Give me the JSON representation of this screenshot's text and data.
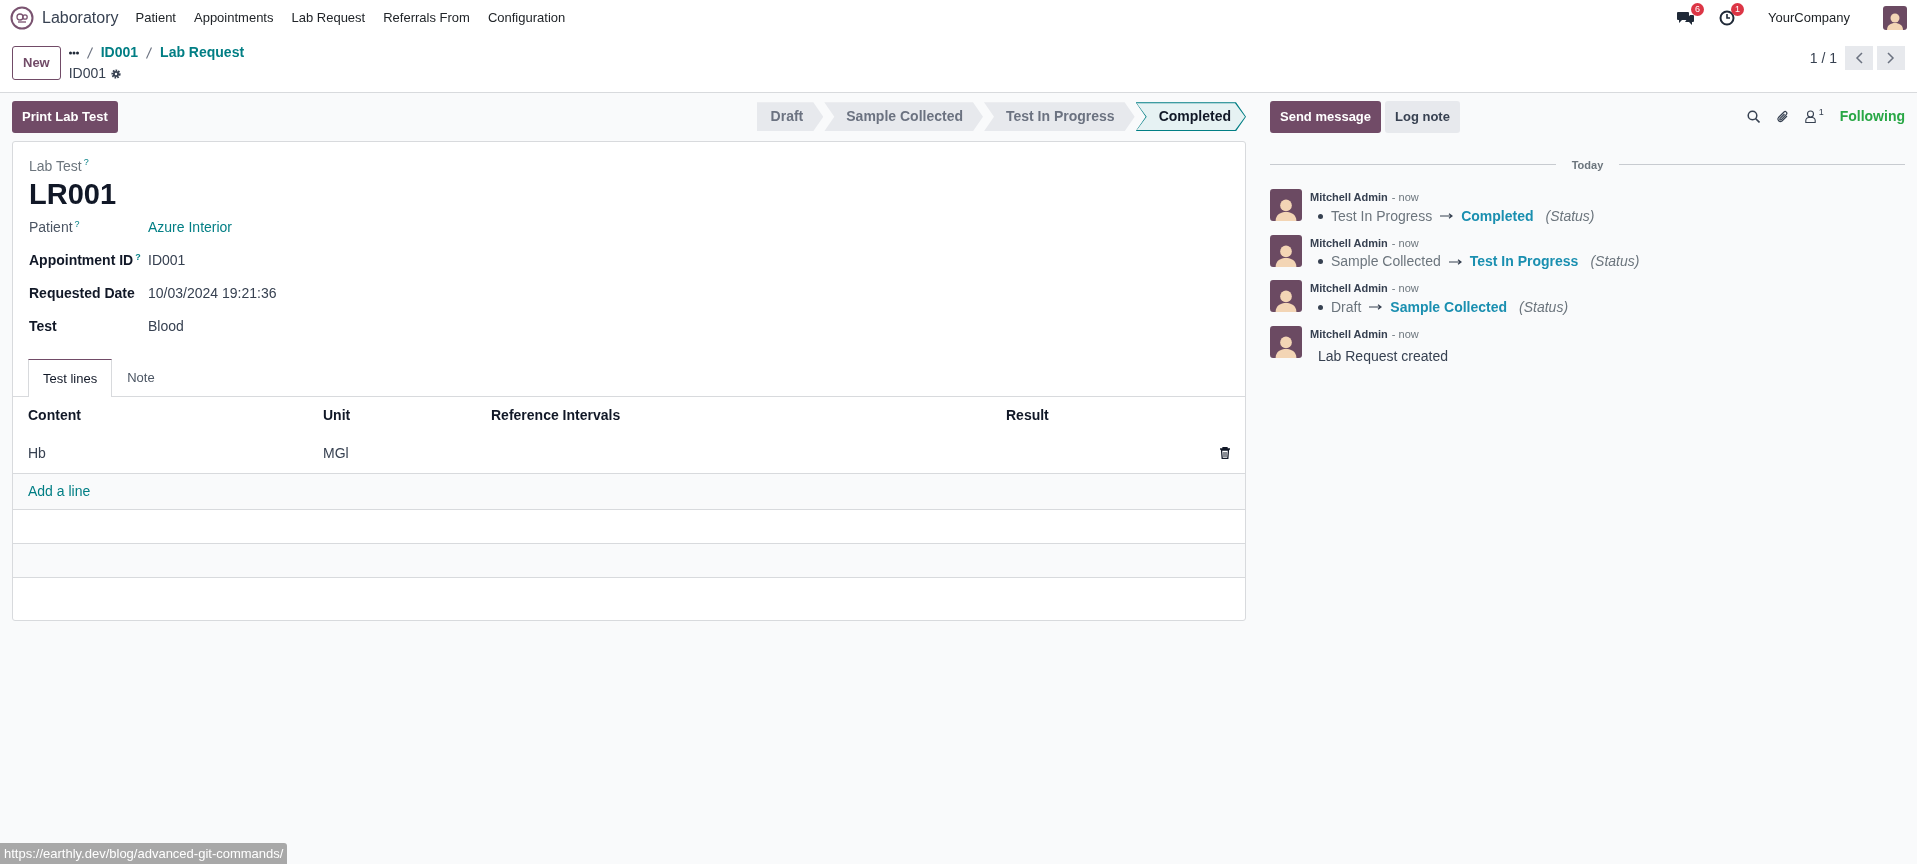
{
  "navbar": {
    "app": "Laboratory",
    "menu": [
      "Patient",
      "Appointments",
      "Lab Request",
      "Referrals From",
      "Configuration"
    ],
    "messages_count": "6",
    "activities_count": "1",
    "company": "YourCompany"
  },
  "control_panel": {
    "new_button": "New",
    "breadcrumbs": [
      "ID001",
      "Lab Request"
    ],
    "record": "ID001",
    "pager": "1 / 1"
  },
  "form": {
    "print_button": "Print Lab Test",
    "stages": [
      {
        "label": "Draft",
        "selected": false
      },
      {
        "label": "Sample Collected",
        "selected": false
      },
      {
        "label": "Test In Progress",
        "selected": false
      },
      {
        "label": "Completed",
        "selected": true
      }
    ],
    "title_label": "Lab Test",
    "title_help": "?",
    "title": "LR001",
    "fields": [
      {
        "label": "Patient",
        "help": "?",
        "value": "Azure Interior",
        "kind": "link"
      },
      {
        "label": "Appointment ID",
        "help": "?",
        "value": "ID001",
        "kind": "text"
      },
      {
        "label": "Requested Date",
        "value": "10/03/2024 19:21:36",
        "kind": "text"
      },
      {
        "label": "Test",
        "value": "Blood",
        "kind": "text"
      }
    ],
    "tabs": [
      {
        "label": "Test lines",
        "selected": true
      },
      {
        "label": "Note",
        "selected": false
      }
    ],
    "table": {
      "columns": [
        "Content",
        "Unit",
        "Reference Intervals",
        "Result"
      ],
      "rows": [
        {
          "content": "Hb",
          "unit": "MGl"
        }
      ],
      "add_line": "Add a line"
    }
  },
  "chatter": {
    "send_button": "Send message",
    "log_button": "Log note",
    "followers_count": "1",
    "follow_label": "Following",
    "date_separator": "Today",
    "messages": [
      {
        "author": "Mitchell Admin",
        "time": "- now",
        "kind": "tracking",
        "old": "Test In Progress",
        "new": "Completed",
        "field": "(Status)"
      },
      {
        "author": "Mitchell Admin",
        "time": "- now",
        "kind": "tracking",
        "old": "Sample Collected",
        "new": "Test In Progress",
        "field": "(Status)"
      },
      {
        "author": "Mitchell Admin",
        "time": "- now",
        "kind": "tracking",
        "old": "Draft",
        "new": "Sample Collected",
        "field": "(Status)"
      },
      {
        "author": "Mitchell Admin",
        "time": "- now",
        "kind": "body",
        "body": "Lab Request created"
      }
    ]
  },
  "status_url": "https://earthly.dev/blog/advanced-git-commands/"
}
